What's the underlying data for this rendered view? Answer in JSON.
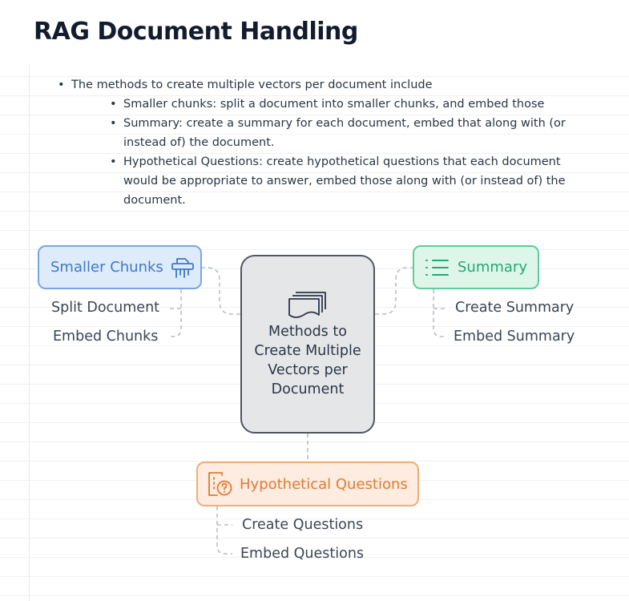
{
  "title": "RAG Document Handling",
  "bullets": {
    "main": "The methods to create multiple vectors per document include",
    "sub": [
      "Smaller chunks: split a document into smaller chunks, and embed those",
      "Summary: create a summary for each document, embed that along with (or instead of) the document.",
      "Hypothetical Questions: create hypothetical questions that each document would be appropriate to answer, embed those along with (or instead of) the document."
    ]
  },
  "diagram": {
    "center": {
      "label": "Methods to Create Multiple Vectors per Document",
      "icon": "document-stack-icon"
    },
    "branches": {
      "chunks": {
        "label": "Smaller Chunks",
        "icon": "shredder-icon",
        "color": "#3f78c8",
        "items": [
          "Split Document",
          "Embed Chunks"
        ]
      },
      "summary": {
        "label": "Summary",
        "icon": "list-icon",
        "color": "#23a86e",
        "items": [
          "Create Summary",
          "Embed Summary"
        ]
      },
      "questions": {
        "label": "Hypothetical Questions",
        "icon": "question-document-icon",
        "color": "#e07a36",
        "items": [
          "Create Questions",
          "Embed Questions"
        ]
      }
    }
  }
}
